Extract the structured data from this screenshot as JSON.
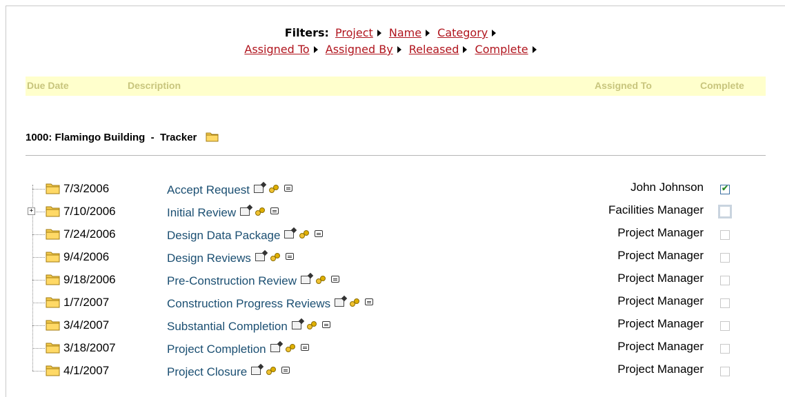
{
  "filters": {
    "label": "Filters:",
    "links": [
      "Project",
      "Name",
      "Category",
      "Assigned To",
      "Assigned By",
      "Released",
      "Complete"
    ]
  },
  "columns": {
    "due_date": "Due Date",
    "description": "Description",
    "assigned_to": "Assigned To",
    "complete": "Complete"
  },
  "project": {
    "title": "1000: Flamingo Building  -  Tracker",
    "folder_icon": "folder-icon"
  },
  "tasks": [
    {
      "date": "7/3/2006",
      "description": "Accept Request",
      "assigned_to": "John Johnson",
      "complete": true
    },
    {
      "date": "7/10/2006",
      "description": "Initial Review",
      "assigned_to": "Facilities Manager",
      "complete": false,
      "expandable": true
    },
    {
      "date": "7/24/2006",
      "description": "Design Data Package",
      "assigned_to": "Project Manager",
      "complete": false
    },
    {
      "date": "9/4/2006",
      "description": "Design Reviews",
      "assigned_to": "Project Manager",
      "complete": false
    },
    {
      "date": "9/18/2006",
      "description": "Pre-Construction Review",
      "assigned_to": "Project Manager",
      "complete": false
    },
    {
      "date": "1/7/2007",
      "description": "Construction Progress Reviews",
      "assigned_to": "Project Manager",
      "complete": false
    },
    {
      "date": "3/4/2007",
      "description": "Substantial Completion",
      "assigned_to": "Project Manager",
      "complete": false
    },
    {
      "date": "3/18/2007",
      "description": "Project Completion",
      "assigned_to": "Project Manager",
      "complete": false
    },
    {
      "date": "4/1/2007",
      "description": "Project Closure",
      "assigned_to": "Project Manager",
      "complete": false
    }
  ],
  "expander_symbol": "+",
  "check_symbol": "✔",
  "colors": {
    "link": "#b0141d",
    "task_text": "#1b4f72",
    "header_bg": "#ffffcc",
    "header_text": "#c8c57d"
  }
}
